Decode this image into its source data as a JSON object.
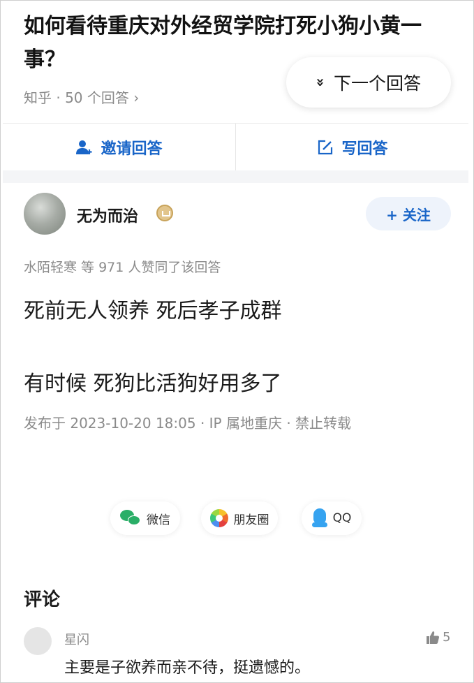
{
  "question": {
    "title": "如何看待重庆对外经贸学院打死小狗小黄一事？",
    "meta": "知乎 · 50 个回答 ›"
  },
  "next_answer": {
    "icon": "chevrons-down-icon",
    "icon_glyph": "»",
    "label": "下一个回答"
  },
  "actions": {
    "invite_label": "邀请回答",
    "write_label": "写回答"
  },
  "answer": {
    "author": "无为而治",
    "follow_label": "+ 关注",
    "likes_text": "水陌轻寒 等 971 人赞同了该回答",
    "content_lines": [
      "死前无人领养 死后孝子成群",
      "有时候 死狗比活狗好用多了"
    ],
    "publish_info": "发布于 2023-10-20 18:05 · IP 属地重庆 · 禁止转载"
  },
  "share": {
    "wechat": "微信",
    "moments": "朋友圈",
    "qq": "QQ"
  },
  "comments": {
    "title": "评论",
    "items": [
      {
        "user": "星闪",
        "text": "主要是子欲养而亲不待，挺遗憾的。",
        "likes": "5"
      }
    ]
  },
  "colors": {
    "accent": "#1965c8",
    "muted_text": "#8a8a8a",
    "wechat_green": "#2aae67",
    "qq_blue": "#36a3f0"
  }
}
